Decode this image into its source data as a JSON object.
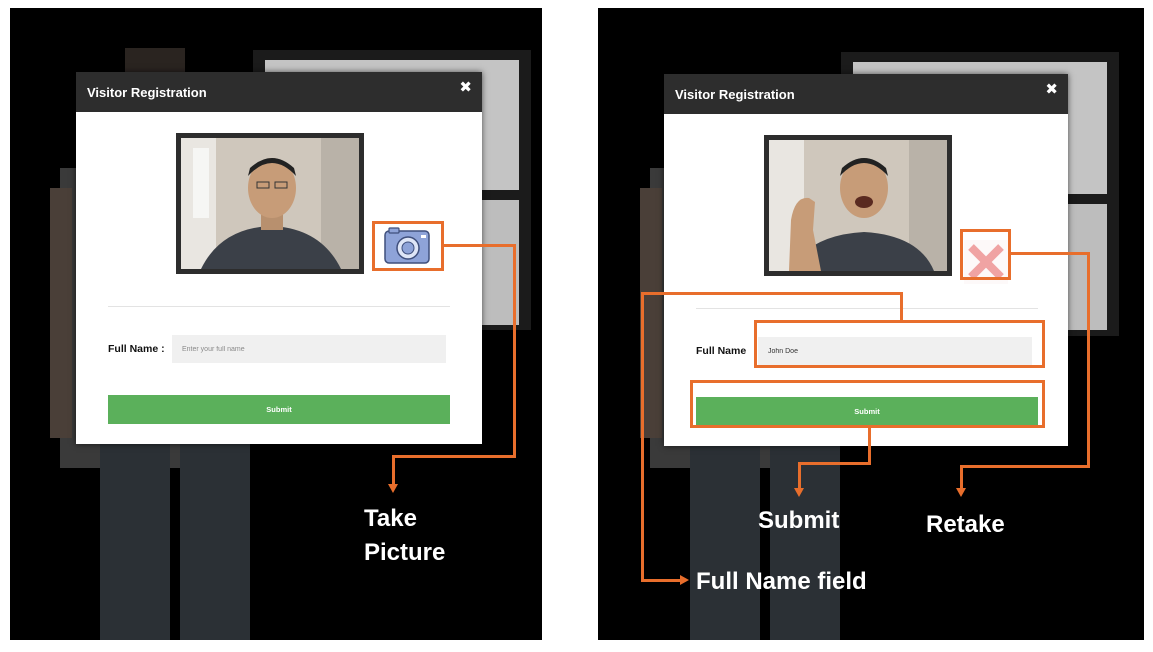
{
  "modal": {
    "title": "Visitor Registration",
    "close_glyph": "✖",
    "name_label_before": "Full Name :",
    "name_label_after": "Full Name",
    "name_placeholder": "Enter your full name",
    "name_value_after": "John Doe",
    "submit_label": "Submit"
  },
  "icons": {
    "before_action": "camera-icon",
    "after_action": "retake-x-icon"
  },
  "callouts": {
    "take_picture_line1": "Take",
    "take_picture_line2": "Picture",
    "submit": "Submit",
    "retake": "Retake",
    "full_name_field": "Full Name field"
  },
  "colors": {
    "annotation_orange": "#e86e2c",
    "submit_green": "#5bb05b",
    "header_dark": "#2d2d2d",
    "camera_blue": "#8ea3d8",
    "retake_pink": "#f0a3a3"
  }
}
